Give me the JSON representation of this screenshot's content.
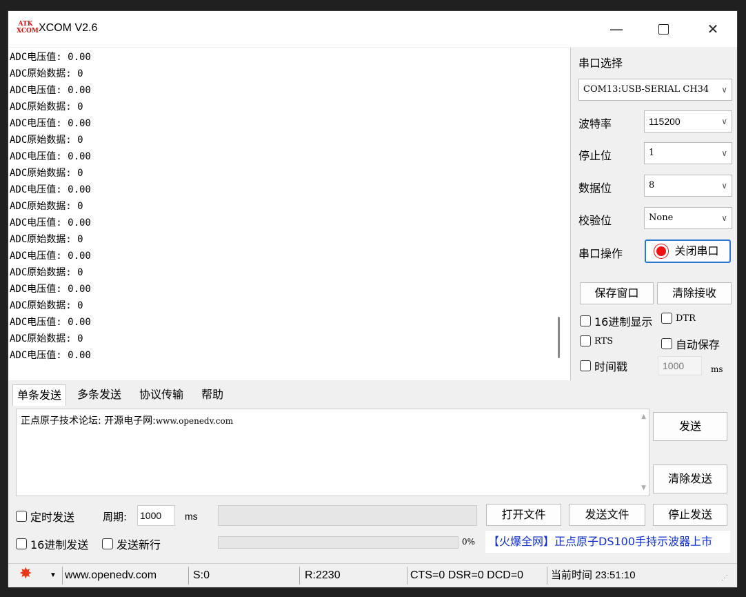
{
  "window": {
    "title": "XCOM V2.6",
    "logo_top": "ATK",
    "logo_bottom": "XCOM",
    "minimize_glyph": "—",
    "close_glyph": "✕"
  },
  "receive_lines": [
    "ADC电压值: 0.00",
    "ADC原始数据: 0",
    "ADC电压值: 0.00",
    "ADC原始数据: 0",
    "ADC电压值: 0.00",
    "ADC原始数据: 0",
    "ADC电压值: 0.00",
    "ADC原始数据: 0",
    "ADC电压值: 0.00",
    "ADC原始数据: 0",
    "ADC电压值: 0.00",
    "ADC原始数据: 0",
    "ADC电压值: 0.00",
    "ADC原始数据: 0",
    "ADC电压值: 0.00",
    "ADC原始数据: 0",
    "ADC电压值: 0.00",
    "ADC原始数据: 0",
    "ADC电压值: 0.00"
  ],
  "settings": {
    "port_label": "串口选择",
    "port_value": "COM13:USB-SERIAL CH34",
    "baud_label": "波特率",
    "baud_value": "115200",
    "stopbits_label": "停止位",
    "stopbits_value": "1",
    "databits_label": "数据位",
    "databits_value": "8",
    "parity_label": "校验位",
    "parity_value": "None",
    "op_label": "串口操作",
    "close_port_button": "关闭串口",
    "save_window_button": "保存窗口",
    "clear_receive_button": "清除接收",
    "hex_display": "16进制显示",
    "dtr": "DTR",
    "rts": "RTS",
    "auto_save": "自动保存",
    "timestamp": "时间戳",
    "timestamp_value": "1000",
    "timestamp_unit": "ms"
  },
  "tabs": [
    "单条发送",
    "多条发送",
    "协议传输",
    "帮助"
  ],
  "send": {
    "text_cn": "正点原子技术论坛: 开源电子网:",
    "text_url": "www.openedv.com",
    "send_button": "发送",
    "clear_send_button": "清除发送"
  },
  "bottom": {
    "timed_send": "定时发送",
    "period_label": "周期:",
    "period_value": "1000",
    "period_unit": "ms",
    "open_file_button": "打开文件",
    "send_file_button": "发送文件",
    "stop_send_button": "停止发送",
    "hex_send": "16进制发送",
    "send_newline": "发送新行",
    "progress_text": "0%",
    "progress_value": 0,
    "promo_text": "【火爆全网】正点原子DS100手持示波器上市"
  },
  "statusbar": {
    "website": "www.openedv.com",
    "sent": "S:0",
    "received": "R:2230",
    "line_status": "CTS=0 DSR=0 DCD=0",
    "time": "当前时间 23:51:10"
  },
  "colors": {
    "accent_red": "#e11111",
    "promo_blue": "#1030d0"
  }
}
